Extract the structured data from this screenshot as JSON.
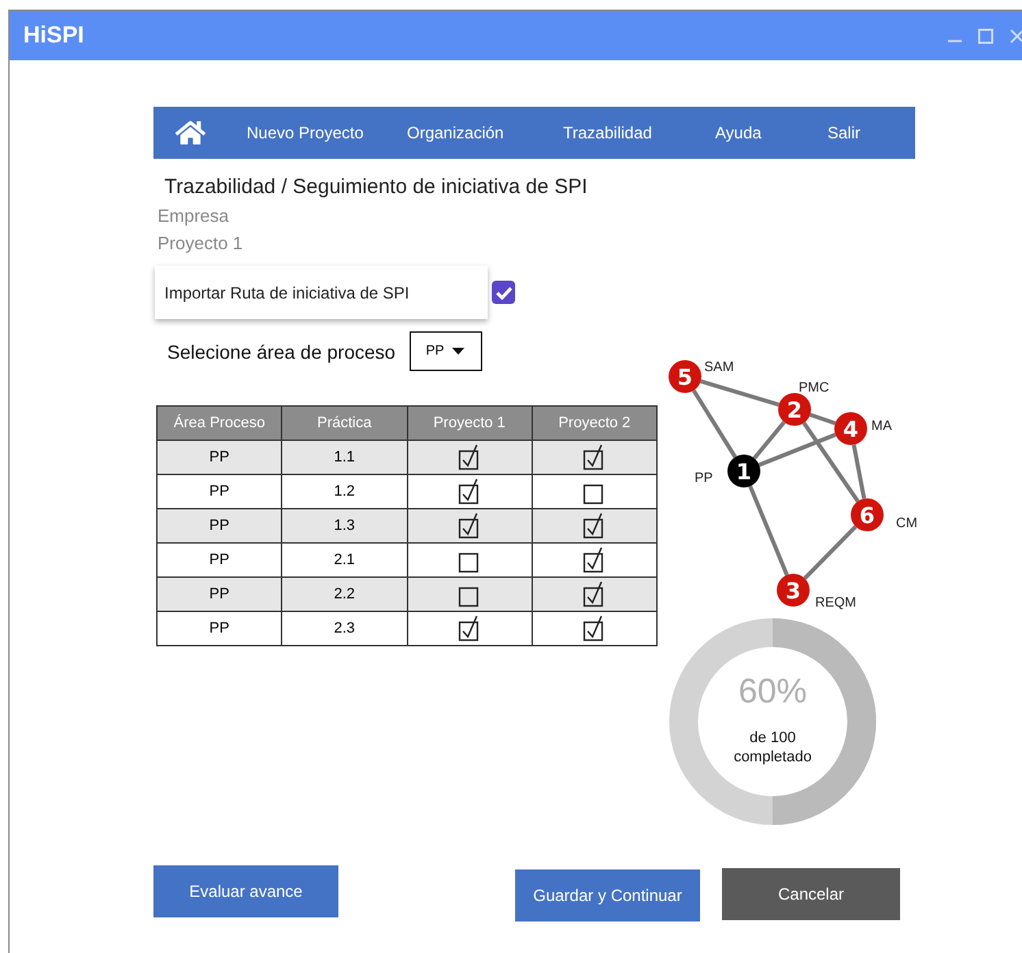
{
  "window": {
    "title": "HiSPI"
  },
  "nav": {
    "items": [
      "Nuevo Proyecto",
      "Organización",
      "Trazabilidad",
      "Ayuda",
      "Salir"
    ]
  },
  "heading": "Trazabilidad / Seguimiento de iniciativa  de SPI",
  "company": "Empresa",
  "project": "Proyecto 1",
  "import_option": {
    "label": "Importar Ruta de iniciativa de SPI",
    "checked": true
  },
  "process_area": {
    "label": "Selecione área de proceso",
    "value": "PP"
  },
  "table": {
    "columns": [
      "Área Proceso",
      "Práctica",
      "Proyecto 1",
      "Proyecto 2"
    ],
    "rows": [
      {
        "area": "PP",
        "practice": "1.1",
        "project_1": true,
        "project_2": true
      },
      {
        "area": "PP",
        "practice": "1.2",
        "project_1": true,
        "project_2": false
      },
      {
        "area": "PP",
        "practice": "1.3",
        "project_1": true,
        "project_2": true
      },
      {
        "area": "PP",
        "practice": "2.1",
        "project_1": false,
        "project_2": true
      },
      {
        "area": "PP",
        "practice": "2.2",
        "project_1": false,
        "project_2": true
      },
      {
        "area": "PP",
        "practice": "2.3",
        "project_1": true,
        "project_2": true
      }
    ]
  },
  "graph": {
    "nodes": [
      {
        "number": "1",
        "label": "PP",
        "color": "#000000"
      },
      {
        "number": "2",
        "label": "PMC",
        "color": "#d0140c"
      },
      {
        "number": "3",
        "label": "REQM",
        "color": "#d0140c"
      },
      {
        "number": "4",
        "label": "MA",
        "color": "#d0140c"
      },
      {
        "number": "5",
        "label": "SAM",
        "color": "#d0140c"
      },
      {
        "number": "6",
        "label": "CM",
        "color": "#d0140c"
      }
    ]
  },
  "progress": {
    "percent": "60%",
    "caption": "de 100 completado"
  },
  "buttons": {
    "evaluate": "Evaluar avance",
    "save": "Guardar y Continuar",
    "cancel": "Cancelar"
  }
}
